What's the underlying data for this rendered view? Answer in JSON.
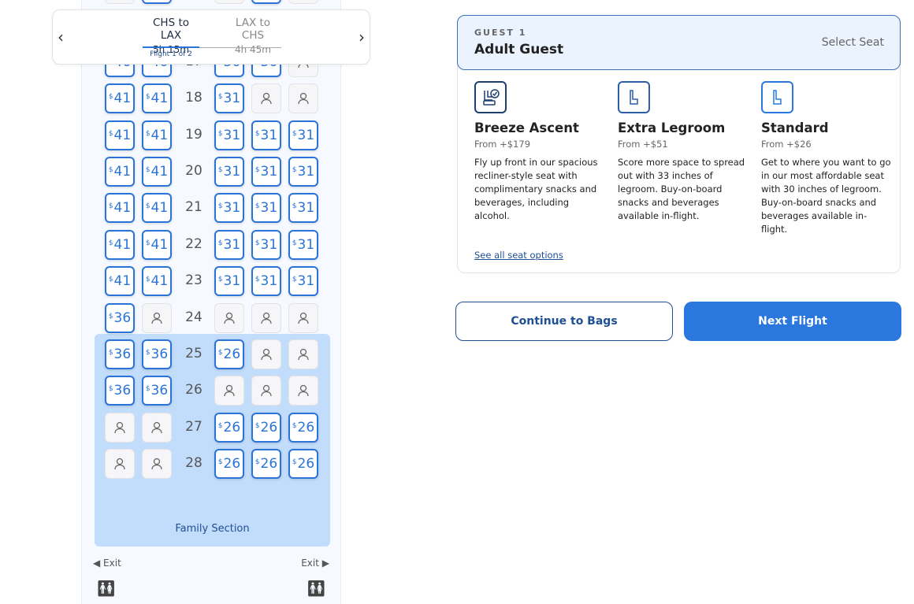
{
  "flight_tabs": [
    {
      "route": "CHS to LAX",
      "duration": "5h 15m",
      "active": true
    },
    {
      "route": "LAX to CHS",
      "duration": "4h 45m",
      "active": false
    }
  ],
  "flight_indicator": "Flight 1 of 2",
  "seat_rows": [
    {
      "row": "",
      "seats": [
        null,
        "",
        null,
        "",
        null
      ]
    },
    {
      "row": "",
      "seats": [
        "",
        "",
        "",
        "",
        null
      ]
    },
    {
      "row": "17",
      "seats": [
        "46",
        "46",
        "36",
        "36",
        null
      ]
    },
    {
      "row": "18",
      "seats": [
        "41",
        "41",
        "31",
        null,
        null
      ]
    },
    {
      "row": "19",
      "seats": [
        "41",
        "41",
        "31",
        "31",
        "31"
      ]
    },
    {
      "row": "20",
      "seats": [
        "41",
        "41",
        "31",
        "31",
        "31"
      ]
    },
    {
      "row": "21",
      "seats": [
        "41",
        "41",
        "31",
        "31",
        "31"
      ]
    },
    {
      "row": "22",
      "seats": [
        "41",
        "41",
        "31",
        "31",
        "31"
      ]
    },
    {
      "row": "23",
      "seats": [
        "41",
        "41",
        "31",
        "31",
        "31"
      ]
    },
    {
      "row": "24",
      "seats": [
        "36",
        null,
        null,
        null,
        null
      ]
    },
    {
      "row": "25",
      "seats": [
        "36",
        "36",
        "26",
        null,
        null
      ]
    },
    {
      "row": "26",
      "seats": [
        "36",
        "36",
        null,
        null,
        null
      ]
    },
    {
      "row": "27",
      "seats": [
        null,
        null,
        "26",
        "26",
        "26"
      ]
    },
    {
      "row": "28",
      "seats": [
        null,
        null,
        "26",
        "26",
        "26"
      ]
    }
  ],
  "family_section_label": "Family Section",
  "exit_left": "Exit",
  "exit_right": "Exit",
  "guest": {
    "label": "GUEST  1",
    "name": "Adult Guest",
    "action": "Select Seat"
  },
  "seat_options": [
    {
      "name": "Breeze Ascent",
      "from": "From +$179",
      "desc": "Fly up front in our spacious recliner-style seat with complimentary snacks and beverages, including alcohol.",
      "color": "#1f3f6e",
      "icon": "premium-seat-icon"
    },
    {
      "name": "Extra Legroom",
      "from": "From +$51",
      "desc": "Score more space to spread out with 33 inches of legroom. Buy-on-board snacks and beverages available in-flight.",
      "color": "#2a5ea8",
      "icon": "legroom-seat-icon"
    },
    {
      "name": "Standard",
      "from": "From +$26",
      "desc": "Get to where you want to go in our most affordable seat with 30 inches of legroom. Buy-on-board snacks and beverages available in-flight.",
      "color": "#2a78de",
      "icon": "standard-seat-icon"
    }
  ],
  "see_all": "See all seat options",
  "buttons": {
    "continue": "Continue to Bags",
    "next": "Next Flight"
  },
  "colors": {
    "accent": "#2a78de",
    "navy": "#1f4f95",
    "family_bg": "#c2dcfb"
  }
}
